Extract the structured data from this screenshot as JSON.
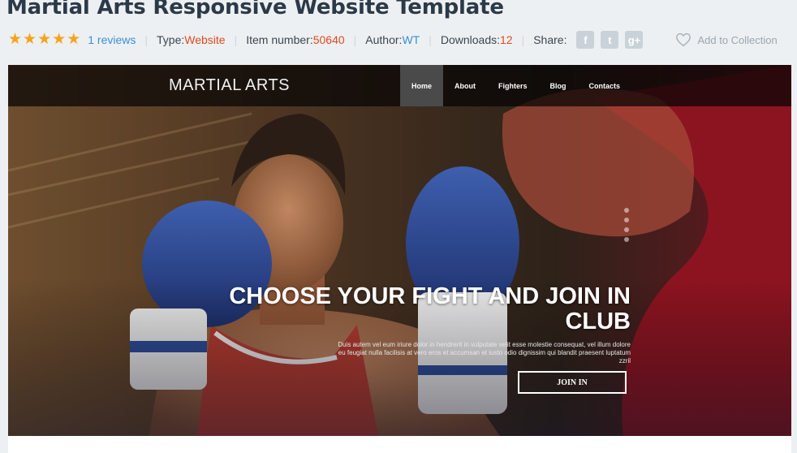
{
  "product": {
    "title": "Martial Arts Responsive Website Template",
    "rating": 5,
    "reviews_label": "1 reviews",
    "type_label": "Type:",
    "type_value": "Website",
    "item_label": "Item number:",
    "item_value": "50640",
    "author_label": "Author:",
    "author_value": "WT",
    "downloads_label": "Downloads:",
    "downloads_value": "12",
    "share_label": "Share:",
    "share_icons": [
      "facebook-icon",
      "twitter-icon",
      "google-plus-icon"
    ],
    "collection_label": "Add to Collection"
  },
  "preview": {
    "logo": "MARTIAL ARTS",
    "nav": [
      "Home",
      "About",
      "Fighters",
      "Blog",
      "Contacts"
    ],
    "active_nav": "Home",
    "headline": "CHOOSE YOUR FIGHT AND JOIN IN CLUB",
    "description": "Duis autem vel eum iriure dolor in hendrerit in vulputate velit esse molestie consequat, vel illum dolore eu feugiat nulla facilisis at vero eros et accumsan et iusto odio dignissim qui blandit praesent luptatum zzril",
    "button": "JOIN IN",
    "slider_dots": 4
  },
  "colors": {
    "star": "#f7a21b",
    "link_blue": "#3a8fd6",
    "value_red": "#e04a1e",
    "title": "#2b3a48"
  }
}
